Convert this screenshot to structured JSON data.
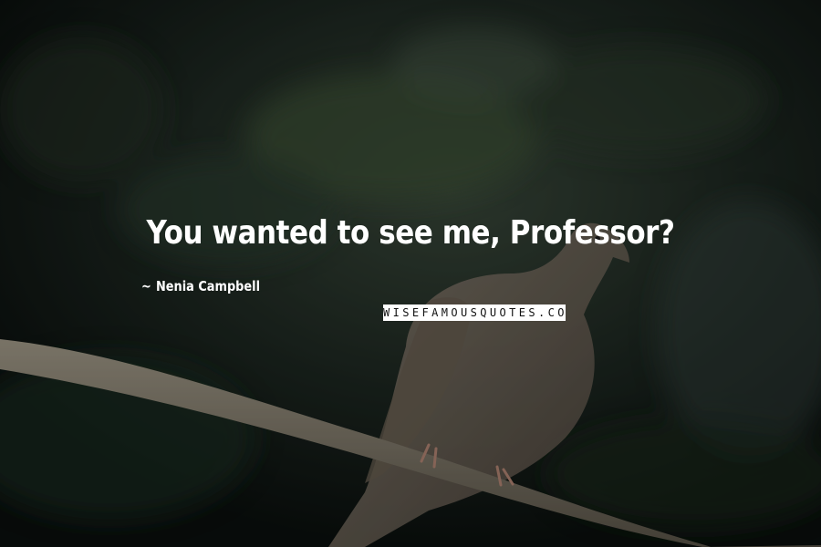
{
  "quote": {
    "text": "You wanted to see me, Professor?",
    "author": "Nenia Campbell",
    "author_prefix": "~"
  },
  "watermark": {
    "text": "WISEFAMOUSQUOTES.COM"
  },
  "colors": {
    "text": "#ffffff",
    "background": "#0e1412",
    "watermark_bg": "#ffffff",
    "watermark_text": "#111111"
  }
}
